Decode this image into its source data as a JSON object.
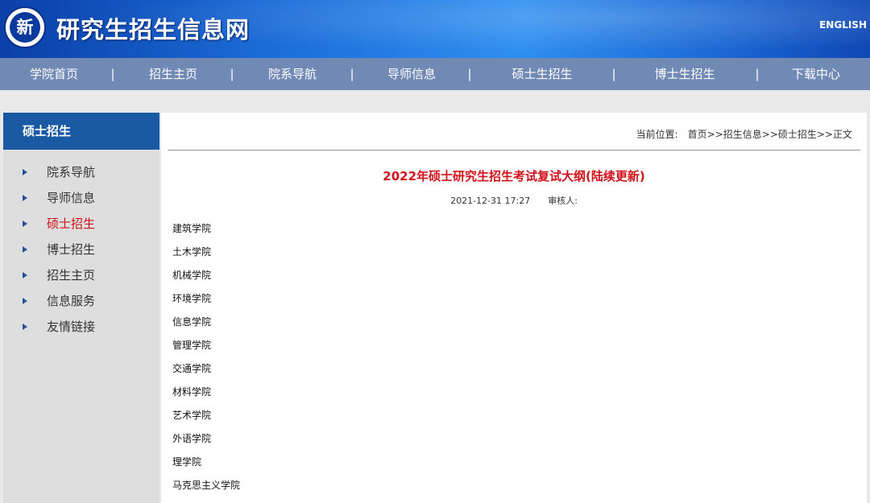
{
  "header": {
    "logo_char": "新",
    "site_title": "研究生招生信息网",
    "english_link": "ENGLISH"
  },
  "nav": {
    "items": [
      "学院首页",
      "招生主页",
      "院系导航",
      "导师信息",
      "硕士生招生",
      "博士生招生",
      "下载中心"
    ],
    "separator": "|"
  },
  "sidebar": {
    "title": "硕士招生",
    "items": [
      "院系导航",
      "导师信息",
      "硕士招生",
      "博士招生",
      "招生主页",
      "信息服务",
      "友情链接"
    ],
    "active_index": 2
  },
  "breadcrumb": {
    "label": "当前位置:",
    "path": "首页>>招生信息>>硕士招生>>正文"
  },
  "article": {
    "title": "2022年硕士研究生招生考试复试大纲(陆续更新)",
    "date": "2021-12-31 17:27",
    "reviewer_label": "审核人:",
    "colleges": [
      "建筑学院",
      "土木学院",
      "机械学院",
      "环境学院",
      "信息学院",
      "管理学院",
      "交通学院",
      "材料学院",
      "艺术学院",
      "外语学院",
      "理学院",
      "马克思主义学院"
    ]
  },
  "colors": {
    "header_blue": "#1b6bd6",
    "nav_bg": "#7189b5",
    "sidebar_title_bg": "#1a5aa5",
    "accent_red": "#d0121a"
  }
}
